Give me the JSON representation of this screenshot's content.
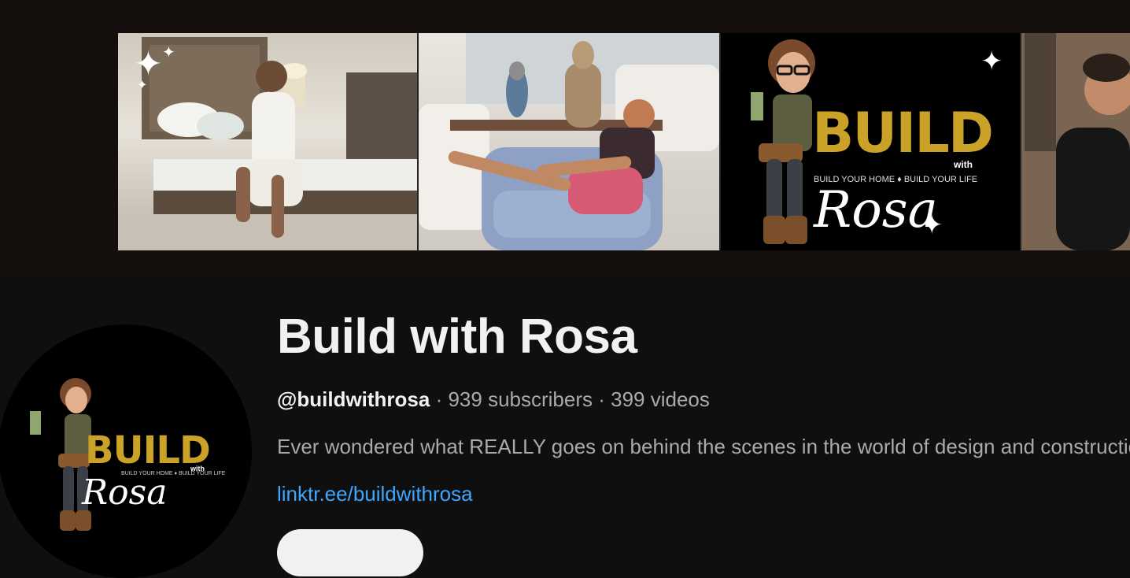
{
  "banner": {
    "logo_word": "BUILD",
    "logo_with": "with",
    "logo_tagline": "BUILD YOUR HOME ♦ BUILD YOUR LIFE",
    "logo_script": "Rosa"
  },
  "avatar": {
    "logo_word": "BUILD",
    "logo_with": "with",
    "logo_tagline": "BUILD YOUR HOME ♦ BUILD YOUR LIFE",
    "logo_script": "Rosa"
  },
  "channel": {
    "title": "Build with Rosa",
    "handle": "@buildwithrosa",
    "separator": " · ",
    "subscribers": "939 subscribers",
    "videos": "399 videos",
    "description": "Ever wondered what REALLY goes on behind the scenes in the world of design and construction",
    "link": "linktr.ee/buildwithrosa"
  },
  "colors": {
    "background": "#0f0f0f",
    "banner_background": "#140f0c",
    "gold": "#c9a227",
    "link": "#3ea6ff"
  }
}
